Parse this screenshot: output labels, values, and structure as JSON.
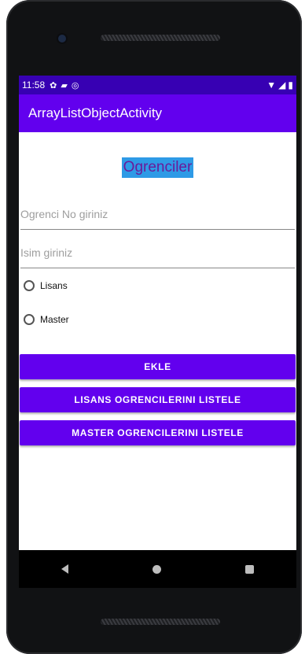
{
  "status": {
    "time": "11:58",
    "left_icons": [
      "settings-icon",
      "sd-card-icon",
      "data-saver-icon"
    ],
    "right_icons": [
      "wifi-icon",
      "signal-icon",
      "battery-icon"
    ]
  },
  "appbar": {
    "title": "ArrayListObjectActivity"
  },
  "content": {
    "heading": "Ogrenciler",
    "student_no_input": {
      "placeholder": "Ogrenci No giriniz",
      "value": ""
    },
    "name_input": {
      "placeholder": "Isim giriniz",
      "value": ""
    },
    "radios": [
      {
        "label": "Lisans",
        "checked": false
      },
      {
        "label": "Master",
        "checked": false
      }
    ],
    "buttons": {
      "add": "EKLE",
      "list_bachelor": "LISANS OGRENCILERINI LISTELE",
      "list_master": "MASTER OGRENCILERINI LISTELE"
    }
  },
  "navbar": {
    "icons": [
      "back-icon",
      "home-icon",
      "recents-icon"
    ]
  },
  "colors": {
    "primary": "#6200ee",
    "primary_dark": "#3700b3",
    "heading_highlight": "#2e9ae6",
    "heading_text": "#6a1b9a"
  }
}
